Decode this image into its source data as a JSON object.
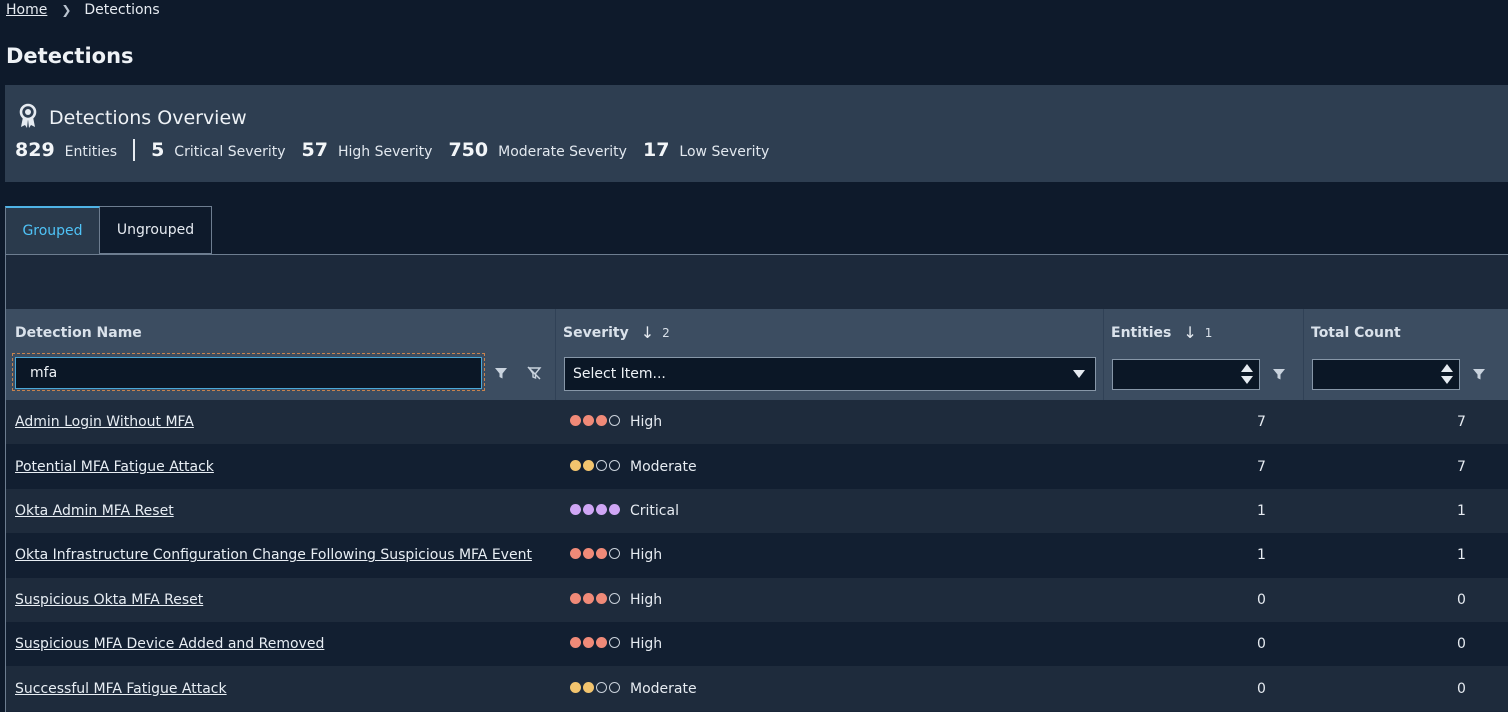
{
  "breadcrumb": {
    "home": "Home",
    "current": "Detections"
  },
  "page_title": "Detections",
  "overview": {
    "title": "Detections Overview",
    "entities_count": "829",
    "entities_label": "Entities",
    "stats": [
      {
        "count": "5",
        "label": "Critical Severity"
      },
      {
        "count": "57",
        "label": "High Severity"
      },
      {
        "count": "750",
        "label": "Moderate Severity"
      },
      {
        "count": "17",
        "label": "Low Severity"
      }
    ]
  },
  "tabs": [
    {
      "label": "Grouped",
      "active": true
    },
    {
      "label": "Ungrouped",
      "active": false
    }
  ],
  "columns": {
    "name": "Detection Name",
    "severity": "Severity",
    "severity_sort_index": "2",
    "entities": "Entities",
    "entities_sort_index": "1",
    "total": "Total Count"
  },
  "filters": {
    "name_value": "mfa",
    "severity_placeholder": "Select Item..."
  },
  "severity_colors": {
    "High": "#f08a78",
    "Moderate": "#f2c46e",
    "Critical": "#cfa6f5",
    "empty_outline": "#c9d1da"
  },
  "rows": [
    {
      "name": "Admin Login Without MFA",
      "severity": "High",
      "level": 3,
      "entities": "7",
      "total": "7"
    },
    {
      "name": "Potential MFA Fatigue Attack",
      "severity": "Moderate",
      "level": 2,
      "entities": "7",
      "total": "7"
    },
    {
      "name": "Okta Admin MFA Reset",
      "severity": "Critical",
      "level": 4,
      "entities": "1",
      "total": "1"
    },
    {
      "name": "Okta Infrastructure Configuration Change Following Suspicious MFA Event",
      "severity": "High",
      "level": 3,
      "entities": "1",
      "total": "1"
    },
    {
      "name": "Suspicious Okta MFA Reset",
      "severity": "High",
      "level": 3,
      "entities": "0",
      "total": "0"
    },
    {
      "name": "Suspicious MFA Device Added and Removed",
      "severity": "High",
      "level": 3,
      "entities": "0",
      "total": "0"
    },
    {
      "name": "Successful MFA Fatigue Attack",
      "severity": "Moderate",
      "level": 2,
      "entities": "0",
      "total": "0"
    }
  ]
}
